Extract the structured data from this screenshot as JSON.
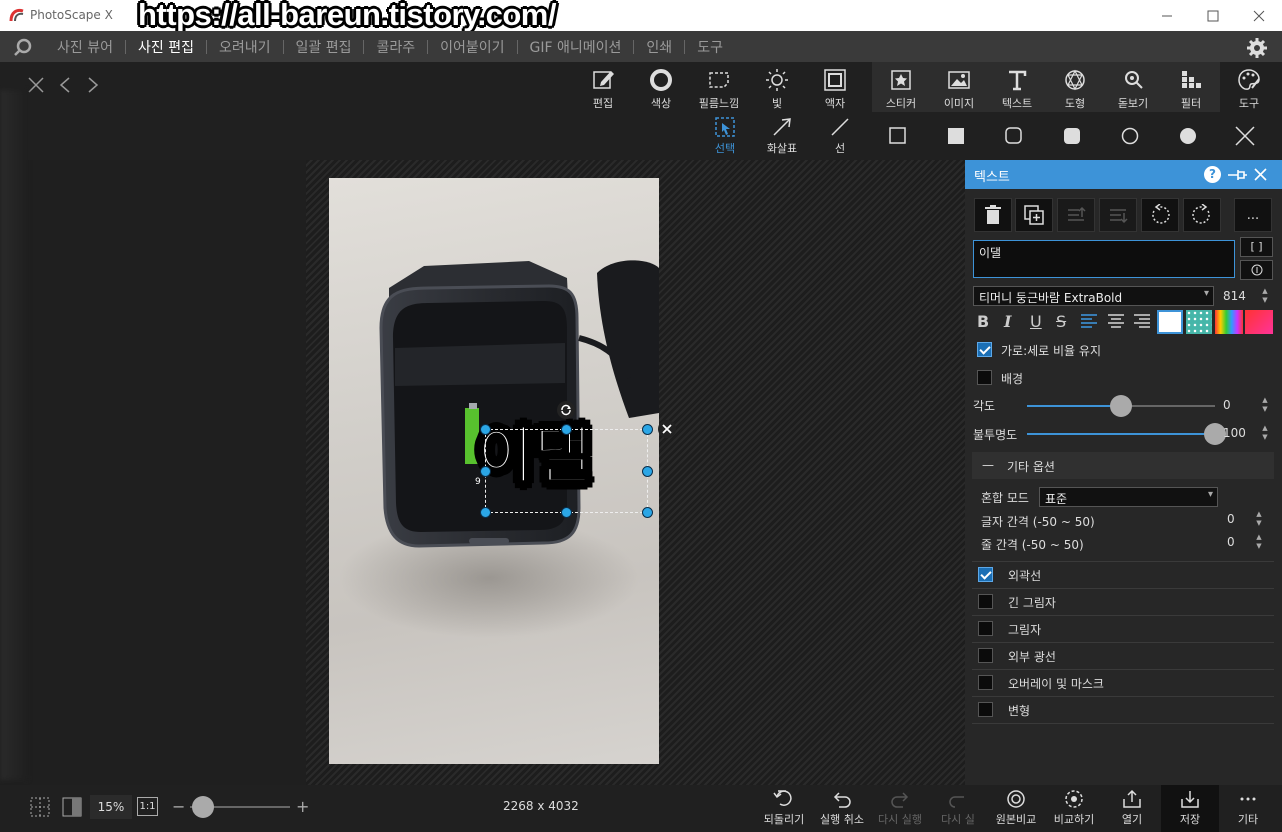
{
  "titlebar": {
    "app_title": "PhotoScape X",
    "watermark": "https://all-bareun.tistory.com/"
  },
  "menu": {
    "items": [
      "사진 뷰어",
      "사진 편집",
      "오려내기",
      "일괄 편집",
      "콜라주",
      "이어붙이기",
      "GIF 애니메이션",
      "인쇄",
      "도구"
    ],
    "active": "사진 편집"
  },
  "toolbar": {
    "left_tools": [
      {
        "label": "편집",
        "icon": "edit-icon"
      },
      {
        "label": "색상",
        "icon": "color-icon"
      },
      {
        "label": "필름느낌",
        "icon": "film-icon"
      },
      {
        "label": "빛",
        "icon": "light-icon"
      },
      {
        "label": "액자",
        "icon": "frame-icon"
      }
    ],
    "right_tools": [
      {
        "label": "스티커",
        "icon": "sticker-icon"
      },
      {
        "label": "이미지",
        "icon": "image-icon"
      },
      {
        "label": "텍스트",
        "icon": "text-icon"
      },
      {
        "label": "도형",
        "icon": "shape-icon"
      },
      {
        "label": "돋보기",
        "icon": "magnifier-icon"
      },
      {
        "label": "필터",
        "icon": "filter-icon"
      },
      {
        "label": "도구",
        "icon": "palette-icon"
      }
    ]
  },
  "subtoolbar": {
    "select": "선택",
    "arrow": "화살표",
    "line": "선"
  },
  "canvas": {
    "text_object": "이댈",
    "dimension_label": "9"
  },
  "panel": {
    "title": "텍스트",
    "text_value": "이댈",
    "bracket_btn": "[ ]",
    "font": "티머니 둥근바람 ExtraBold",
    "font_size": "814",
    "format_buttons": [
      "B",
      "I",
      "U",
      "S"
    ],
    "keep_ratio": {
      "label": "가로:세로 비율 유지",
      "checked": true
    },
    "background": {
      "label": "배경",
      "checked": false
    },
    "angle": {
      "label": "각도",
      "value": "0",
      "fraction": 0.5
    },
    "opacity": {
      "label": "불투명도",
      "value": "100",
      "fraction": 1.0
    },
    "more_options": {
      "label": "기타 옵션",
      "toggle": "—"
    },
    "blend_mode": {
      "label": "혼합 모드",
      "value": "표준"
    },
    "letter_spacing": {
      "label": "글자 간격 (-50 ~ 50)",
      "value": "0"
    },
    "line_spacing": {
      "label": "줄 간격 (-50 ~ 50)",
      "value": "0"
    },
    "effects": [
      {
        "label": "외곽선",
        "checked": true
      },
      {
        "label": "긴 그림자",
        "checked": false
      },
      {
        "label": "그림자",
        "checked": false
      },
      {
        "label": "외부 광선",
        "checked": false
      },
      {
        "label": "오버레이 및 마스크",
        "checked": false
      },
      {
        "label": "변형",
        "checked": false
      }
    ],
    "more_btn": "..."
  },
  "statusbar": {
    "zoom": "15%",
    "one_to_one": "1:1",
    "image_size": "2268 x 4032",
    "buttons": [
      {
        "label": "되돌리기",
        "enabled": true
      },
      {
        "label": "실행 취소",
        "enabled": true
      },
      {
        "label": "다시 실행",
        "enabled": false
      },
      {
        "label": "다시 실",
        "enabled": false
      },
      {
        "label": "원본비교",
        "enabled": true
      },
      {
        "label": "비교하기",
        "enabled": true
      },
      {
        "label": "열기",
        "enabled": true
      },
      {
        "label": "저장",
        "enabled": true
      },
      {
        "label": "기타",
        "enabled": true
      }
    ]
  },
  "colors": {
    "accent": "#3d93d8",
    "handle": "#2ba6e6",
    "menu_bg": "#3a3a3a",
    "panel_bg": "#272727"
  }
}
